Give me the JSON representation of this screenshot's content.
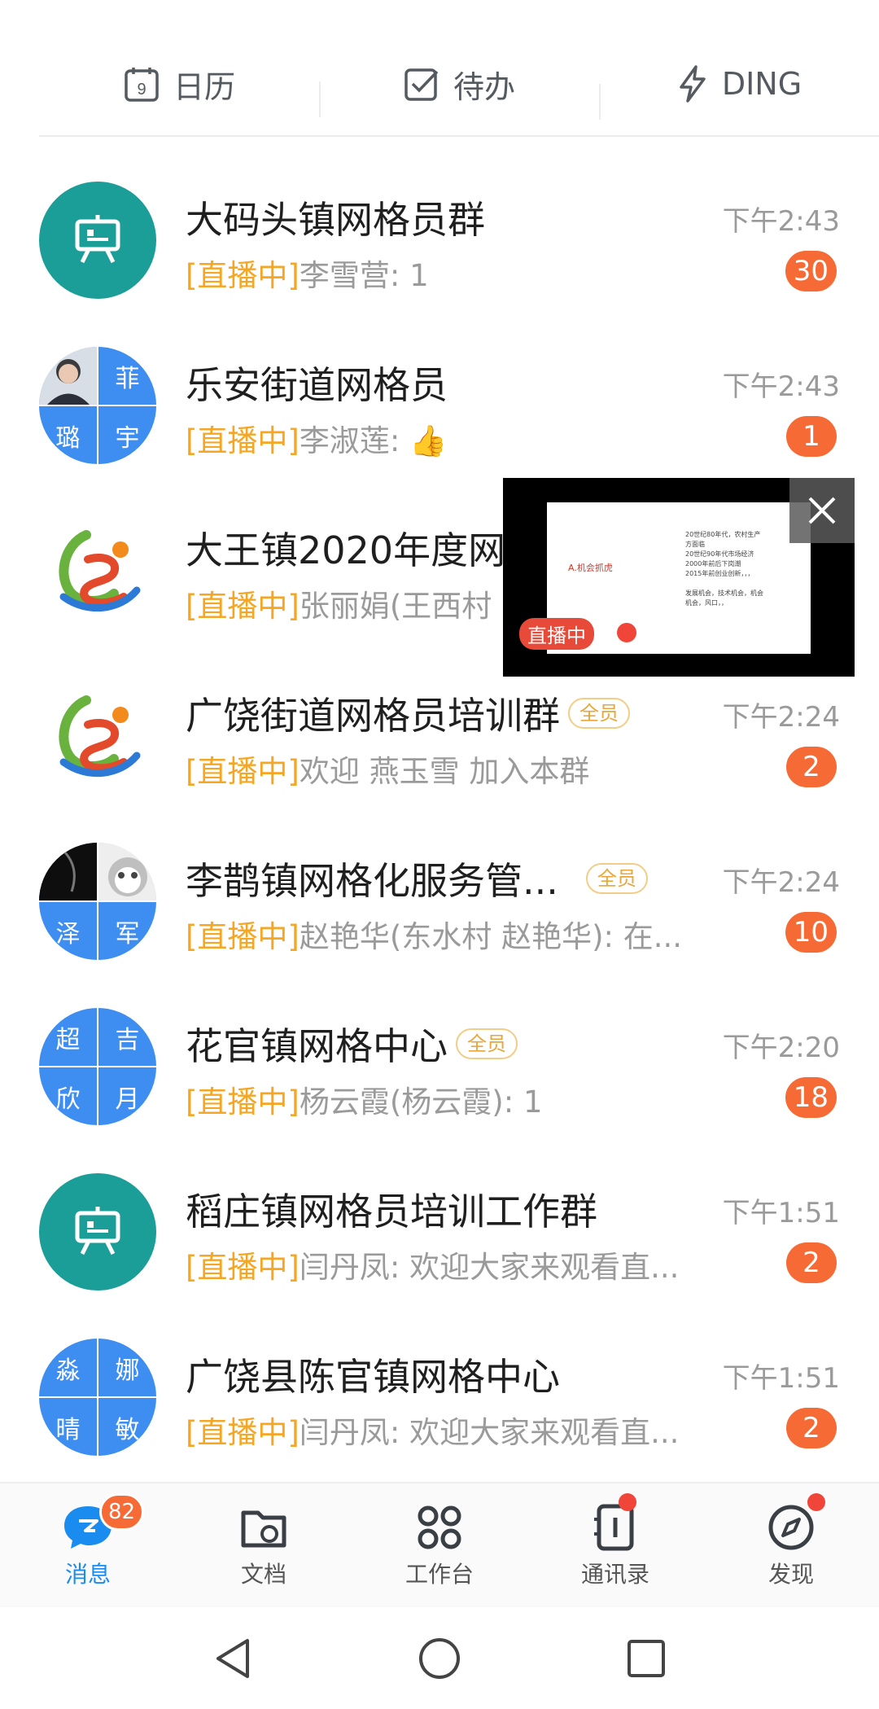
{
  "topbar": {
    "calendar_label": "日历",
    "calendar_day": "9",
    "todo_label": "待办",
    "ding_label": "DING"
  },
  "chats": [
    {
      "title": "大码头镇网格员群",
      "live": "[直播中]",
      "preview": "李雪营: 1",
      "time": "下午2:43",
      "badge": "30",
      "all_tag": ""
    },
    {
      "title": "乐安街道网格员",
      "live": "[直播中]",
      "preview": "李淑莲: 👍",
      "time": "下午2:43",
      "badge": "1",
      "all_tag": "",
      "avatar_chars": [
        "",
        "菲",
        "璐",
        "宇"
      ]
    },
    {
      "title": "大王镇2020年度网",
      "live": "[直播中]",
      "preview": "张丽娟(王西村",
      "time": "",
      "badge": "",
      "all_tag": ""
    },
    {
      "title": "广饶街道网格员培训群",
      "live": "[直播中]",
      "preview": "欢迎 燕玉雪 加入本群",
      "time": "下午2:24",
      "badge": "2",
      "all_tag": "全员"
    },
    {
      "title": "李鹊镇网格化服务管...",
      "live": "[直播中]",
      "preview": "赵艳华(东水村 赵艳华): 在...",
      "time": "下午2:24",
      "badge": "10",
      "all_tag": "全员",
      "avatar_chars": [
        "",
        "",
        "泽",
        "军"
      ]
    },
    {
      "title": "花官镇网格中心",
      "live": "[直播中]",
      "preview": "杨云霞(杨云霞): 1",
      "time": "下午2:20",
      "badge": "18",
      "all_tag": "全员",
      "avatar_chars": [
        "超",
        "吉",
        "欣",
        "月"
      ]
    },
    {
      "title": "稻庄镇网格员培训工作群",
      "live": "[直播中]",
      "preview": "闫丹凤: 欢迎大家来观看直...",
      "time": "下午1:51",
      "badge": "2",
      "all_tag": ""
    },
    {
      "title": "广饶县陈官镇网格中心",
      "live": "[直播中]",
      "preview": "闫丹凤: 欢迎大家来观看直...",
      "time": "下午1:51",
      "badge": "2",
      "all_tag": "",
      "avatar_chars": [
        "淼",
        "娜",
        "晴",
        "敏"
      ]
    }
  ],
  "live_window": {
    "status": "直播中",
    "slide_title": "A.机会抓虎",
    "slide_lines": "20世纪80年代，农村生产\n方面临\n20世纪90年代市场经济\n2000年前后下岗潮\n2015年前创业创新，，，\n\n发展机会，技术机会，机会\n机会，风口，，"
  },
  "tabbar": {
    "tabs": [
      {
        "label": "消息",
        "icon": "chat-bubble-icon",
        "badge": "82"
      },
      {
        "label": "文档",
        "icon": "document-folder-icon"
      },
      {
        "label": "工作台",
        "icon": "workbench-grid-icon"
      },
      {
        "label": "通讯录",
        "icon": "contacts-book-icon"
      },
      {
        "label": "发现",
        "icon": "compass-icon"
      }
    ]
  },
  "colors": {
    "accent": "#1a8cf0",
    "live": "#f5a623",
    "badge": "#f56a35",
    "avatar_teal": "#1b9d98",
    "avatar_blue": "#3d8ef0"
  }
}
